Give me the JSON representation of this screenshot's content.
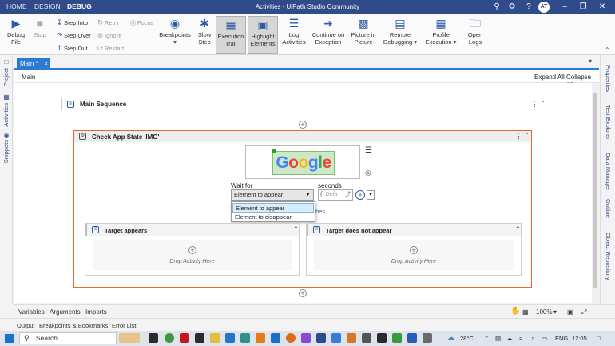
{
  "titlebar": {
    "tabs": [
      "HOME",
      "DESIGN",
      "DEBUG"
    ],
    "active_tab": "DEBUG",
    "title": "Activities - UiPath Studio Community",
    "user_initials": "AT"
  },
  "ribbon": {
    "debug_file": "Debug File",
    "stop": "Stop",
    "step_into": "Step Into",
    "step_over": "Step Over",
    "step_out": "Step Out",
    "retry": "Retry",
    "ignore": "Ignore",
    "restart": "Restart",
    "focus": "Focus",
    "breakpoints": "Breakpoints",
    "slow_step": "Slow Step",
    "execution_trail": "Execution Trail",
    "highlight_elements": "Highlight Elements",
    "log_activities": "Log Activities",
    "continue_on_exception": "Continue on Exception",
    "picture_in_picture": "Picture in Picture",
    "remote_debugging": "Remote Debugging",
    "profile_execution": "Profile Execution",
    "open_logs": "Open Logs"
  },
  "left_rail": [
    "Project",
    "Activities",
    "Snippets"
  ],
  "right_rail": [
    "Properties",
    "Test Explorer",
    "Data Manager",
    "Outline",
    "Object Repository"
  ],
  "doc_tab": {
    "label": "Main *",
    "close": "×"
  },
  "designer": {
    "breadcrumb": "Main",
    "expand_all": "Expand All",
    "collapse_all": "Collapse All"
  },
  "workflow": {
    "sequence_title": "Main Sequence",
    "check_app_state": {
      "title": "Check App State 'IMG'",
      "image_text": "Google",
      "wait_for_label": "Wait for",
      "wait_for_value": "Element to appear",
      "seconds_label": "seconds",
      "seconds_placeholder": "Defa",
      "dropdown_options": [
        "Element to appear",
        "Element to disappear"
      ],
      "behind_dropdown_text": "hes",
      "target_appears": "Target appears",
      "target_not_appear": "Target does not appear",
      "drop_activity": "Drop Activity Here"
    }
  },
  "bottom": {
    "tabs1": [
      "Variables",
      "Arguments",
      "Imports"
    ],
    "zoom": "100%",
    "tabs2": [
      "Output",
      "Breakpoints & Bookmarks",
      "Error List"
    ]
  },
  "taskbar": {
    "search": "Search",
    "temperature": "28°C",
    "language": "ENG",
    "time": "12:05"
  }
}
